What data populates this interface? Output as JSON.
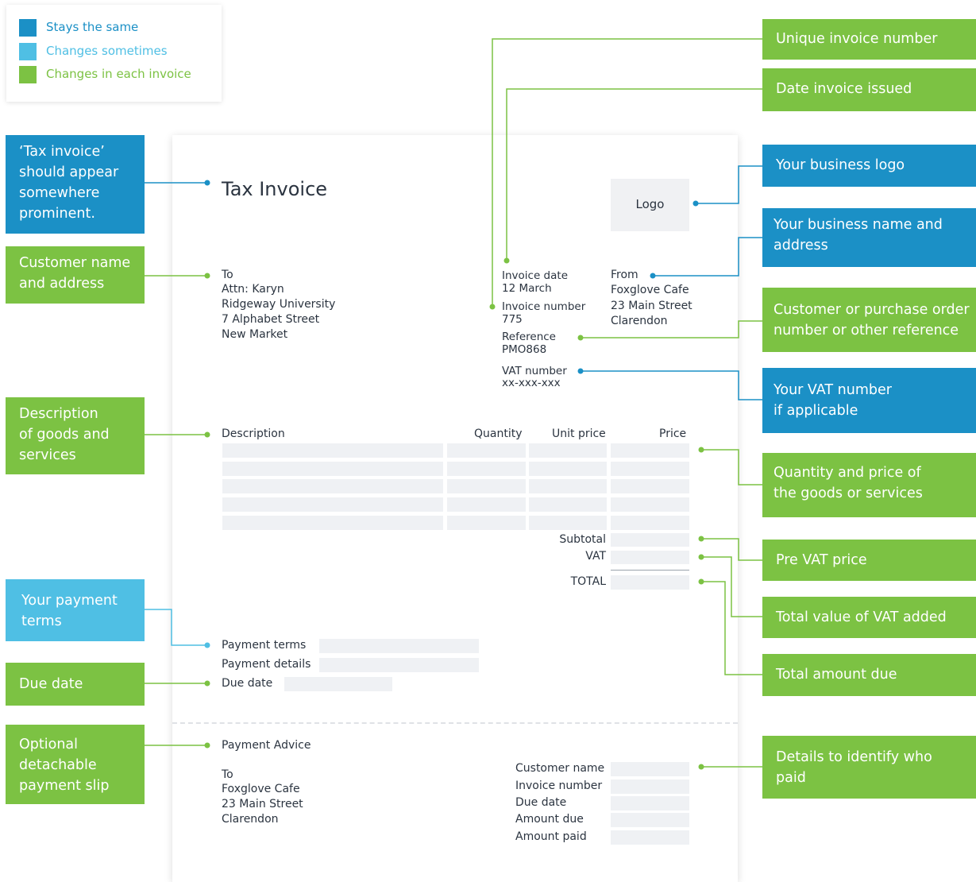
{
  "colors": {
    "stays_the_same": "#1b90c6",
    "changes_sometimes": "#4fbfe4",
    "changes_each_invoice": "#7cc243"
  },
  "legend": {
    "stays_the_same": "Stays the same",
    "changes_sometimes": "Changes sometimes",
    "changes_each_invoice": "Changes in each invoice"
  },
  "invoice": {
    "title": "Tax Invoice",
    "logo": "Logo",
    "to": {
      "heading": "To",
      "attn": "Attn: Karyn",
      "line1": "Ridgeway University",
      "line2": "7 Alphabet Street",
      "line3": "New Market"
    },
    "invoice_date_label": "Invoice date",
    "invoice_date_value": "12 March",
    "invoice_number_label": "Invoice number",
    "invoice_number_value": "775",
    "reference_label": "Reference",
    "reference_value": "PMO868",
    "vat_number_label": "VAT number",
    "vat_number_value": "xx-xxx-xxx",
    "from": {
      "heading": "From",
      "name": "Foxglove Cafe",
      "line1": "23 Main Street",
      "line2": "Clarendon"
    },
    "table_headers": {
      "description": "Description",
      "quantity": "Quantity",
      "unit_price": "Unit price",
      "price": "Price"
    },
    "subtotal": "Subtotal",
    "vat": "VAT",
    "total": "TOTAL",
    "payment_terms": "Payment terms",
    "payment_details": "Payment details",
    "due_date": "Due date",
    "payment_advice": {
      "title": "Payment Advice",
      "to": "To",
      "name": "Foxglove Cafe",
      "line1": "23 Main Street",
      "line2": "Clarendon",
      "customer_name": "Customer name",
      "invoice_number": "Invoice number",
      "due_date": "Due date",
      "amount_due": "Amount due",
      "amount_paid": "Amount paid"
    }
  },
  "callouts": {
    "unique_invoice_number": "Unique invoice number",
    "date_invoice_issued": "Date invoice issued",
    "business_logo": "Your business logo",
    "business_name_address": "Your business name and address",
    "customer_reference": "Customer or purchase order number or other reference",
    "vat_number": "Your VAT number if applicable",
    "quantity_price": "Quantity and price of the goods or services",
    "pre_vat_price": "Pre VAT price",
    "total_vat": "Total value of VAT added",
    "total_due": "Total amount due",
    "details_who_paid": "Details to identify who paid",
    "tax_invoice_prominent": "‘Tax invoice’ should appear somewhere prominent.",
    "customer_name_address": "Customer name and address",
    "description_goods": "Description of goods and services",
    "payment_terms": "Your payment terms",
    "due_date": "Due date",
    "detachable_slip": "Optional detachable payment slip"
  }
}
